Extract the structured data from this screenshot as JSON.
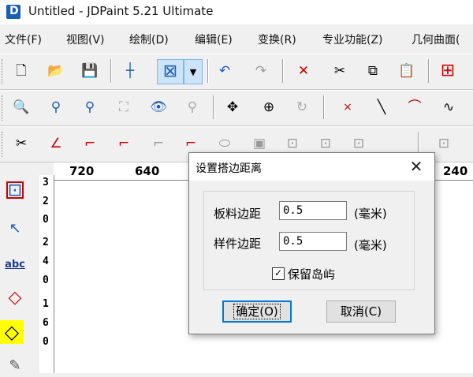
{
  "window": {
    "title": "Untitled - JDPaint 5.21 Ultimate"
  },
  "menu": [
    "文件(F)",
    "视图(V)",
    "绘制(D)",
    "编辑(E)",
    "变换(R)",
    "专业功能(Z)",
    "几何曲面("
  ],
  "toolbar1": [
    {
      "icon": "new-file-icon",
      "glyph": "🗋"
    },
    {
      "icon": "open-folder-icon",
      "glyph": "📂"
    },
    {
      "icon": "save-icon",
      "glyph": "💾"
    },
    {
      "icon": "crosshair-icon",
      "glyph": "┼"
    },
    {
      "icon": "select-box-icon",
      "glyph": "⊠"
    },
    {
      "icon": "dropdown-arrow-icon",
      "glyph": "▼"
    },
    {
      "icon": "undo-icon",
      "glyph": "↶"
    },
    {
      "icon": "redo-icon",
      "glyph": "↷"
    },
    {
      "icon": "delete-icon",
      "glyph": "✕"
    },
    {
      "icon": "cut-icon",
      "glyph": "✂"
    },
    {
      "icon": "copy-icon",
      "glyph": "⧉"
    },
    {
      "icon": "paste-icon",
      "glyph": "📋"
    },
    {
      "icon": "origin-icon",
      "glyph": "⊞"
    }
  ],
  "toolbar2": [
    {
      "icon": "zoom-window-icon",
      "glyph": "🔍"
    },
    {
      "icon": "zoom-out-icon",
      "glyph": "⚲"
    },
    {
      "icon": "zoom-in-icon",
      "glyph": "⚲"
    },
    {
      "icon": "zoom-all-icon",
      "glyph": "⛶"
    },
    {
      "icon": "view-eye-icon",
      "glyph": "👁"
    },
    {
      "icon": "zoom-previous-icon",
      "glyph": "⚲"
    },
    {
      "icon": "pan-icon",
      "glyph": "✥"
    },
    {
      "icon": "zoom-realtime-icon",
      "glyph": "⊕"
    },
    {
      "icon": "rotate-view-icon",
      "glyph": "↻"
    },
    {
      "icon": "point-icon",
      "glyph": "×"
    },
    {
      "icon": "line-icon",
      "glyph": "╲"
    },
    {
      "icon": "arc-icon",
      "glyph": "⌒"
    },
    {
      "icon": "spline-icon",
      "glyph": "∿"
    }
  ],
  "toolbar3": [
    {
      "icon": "trim-icon",
      "glyph": "✂"
    },
    {
      "icon": "angle-icon",
      "glyph": "∠"
    },
    {
      "icon": "fillet-icon",
      "glyph": "⌐"
    },
    {
      "icon": "chamfer-icon",
      "glyph": "⌐"
    },
    {
      "icon": "corner-icon",
      "glyph": "⌐"
    },
    {
      "icon": "offset-corner-icon",
      "glyph": "⌐"
    },
    {
      "icon": "ellipse-icon",
      "glyph": "⬭"
    },
    {
      "icon": "frame-icon",
      "glyph": "▣"
    },
    {
      "icon": "group-icon",
      "glyph": "⊡"
    },
    {
      "icon": "ungroup-icon",
      "glyph": "⊡"
    },
    {
      "icon": "layer-icon",
      "glyph": "⊡"
    },
    {
      "icon": "nest-icon",
      "glyph": "⊡"
    }
  ],
  "left_toolbar": [
    {
      "icon": "select-node-icon",
      "glyph": "⊡"
    },
    {
      "icon": "pointer-icon",
      "glyph": "↖"
    },
    {
      "icon": "text-abc-icon",
      "glyph": "abc"
    },
    {
      "icon": "diamond-circle-icon",
      "glyph": "◇"
    },
    {
      "icon": "shape-icon",
      "glyph": "◇"
    },
    {
      "icon": "pen-icon",
      "glyph": "✎"
    }
  ],
  "ruler": {
    "horizontal": [
      "720",
      "640",
      "240"
    ],
    "vertical": [
      "3",
      "2",
      "0",
      "2",
      "4",
      "0",
      "1",
      "6",
      "0"
    ]
  },
  "dialog": {
    "title": "设置搭边距离",
    "close_glyph": "✕",
    "sheet_margin_label": "板料边距",
    "sheet_margin_value": "0.5",
    "sheet_margin_unit": "(毫米)",
    "part_margin_label": "样件边距",
    "part_margin_value": "0.5",
    "part_margin_unit": "(毫米)",
    "keep_islands_label": "保留岛屿",
    "keep_islands_checked": true,
    "ok_label": "确定(O)",
    "cancel_label": "取消(C)"
  }
}
